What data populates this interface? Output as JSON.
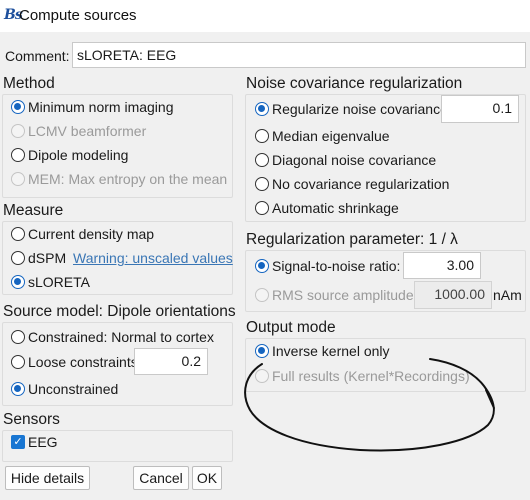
{
  "window": {
    "app_icon": "Bs",
    "title": "Compute sources"
  },
  "comment": {
    "label": "Comment:",
    "value": "sLORETA: EEG"
  },
  "method": {
    "title": "Method",
    "options": [
      {
        "label": "Minimum norm imaging",
        "selected": true,
        "enabled": true
      },
      {
        "label": "LCMV beamformer",
        "selected": false,
        "enabled": false
      },
      {
        "label": "Dipole modeling",
        "selected": false,
        "enabled": true
      },
      {
        "label": "MEM: Max entropy on the mean",
        "selected": false,
        "enabled": false
      }
    ]
  },
  "measure": {
    "title": "Measure",
    "options": [
      {
        "label": "Current density map",
        "selected": false
      },
      {
        "label": "dSPM",
        "selected": false
      },
      {
        "label": "sLORETA",
        "selected": true
      }
    ],
    "warning_link": "Warning: unscaled values"
  },
  "source_model": {
    "title": "Source model: Dipole orientations",
    "options": [
      {
        "label": "Constrained:  Normal to cortex",
        "selected": false
      },
      {
        "label": "Loose constraints",
        "selected": false
      },
      {
        "label": "Unconstrained",
        "selected": true
      }
    ],
    "loose_value": "0.2"
  },
  "sensors": {
    "title": "Sensors",
    "eeg_label": "EEG",
    "eeg_checked": true
  },
  "noise_cov": {
    "title": "Noise covariance regularization",
    "options": [
      {
        "label": "Regularize noise covariance:",
        "selected": true
      },
      {
        "label": "Median eigenvalue",
        "selected": false
      },
      {
        "label": "Diagonal noise covariance",
        "selected": false
      },
      {
        "label": "No covariance regularization",
        "selected": false
      },
      {
        "label": "Automatic shrinkage",
        "selected": false
      }
    ],
    "regularize_value": "0.1"
  },
  "reg_param": {
    "title": "Regularization parameter: 1 / λ",
    "snr_label": "Signal-to-noise ratio:",
    "snr_value": "3.00",
    "rms_label": "RMS source amplitude:",
    "rms_value": "1000.00",
    "rms_unit": "nAm"
  },
  "output_mode": {
    "title": "Output mode",
    "options": [
      {
        "label": "Inverse kernel only",
        "selected": true,
        "enabled": true
      },
      {
        "label": "Full results (Kernel*Recordings)",
        "selected": false,
        "enabled": false
      }
    ]
  },
  "buttons": {
    "hide_details": "Hide details",
    "cancel": "Cancel",
    "ok": "OK"
  },
  "annotation": {
    "color": "#111111"
  }
}
